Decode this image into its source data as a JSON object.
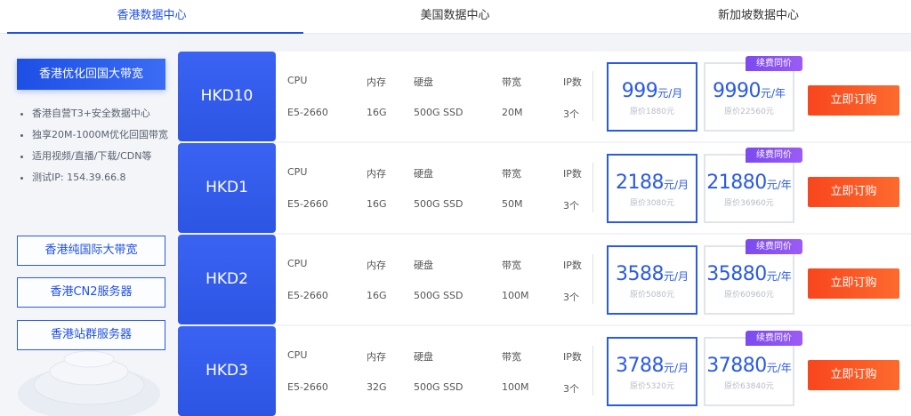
{
  "tabs": [
    {
      "label": "香港数据中心",
      "active": true
    },
    {
      "label": "美国数据中心",
      "active": false
    },
    {
      "label": "新加坡数据中心",
      "active": false
    }
  ],
  "sidebar": {
    "primary_button": "香港优化回国大带宽",
    "features": [
      "香港自营T3+安全数据中心",
      "独享20M-1000M优化回国带宽",
      "适用视频/直播/下载/CDN等",
      "测试IP: 154.39.66.8"
    ],
    "links": [
      "香港纯国际大带宽",
      "香港CN2服务器",
      "香港站群服务器"
    ]
  },
  "spec_headers": {
    "cpu": "CPU",
    "ram": "内存",
    "disk": "硬盘",
    "bandwidth": "带宽",
    "ip": "IP数"
  },
  "badge_label": "续费同价",
  "buy_label": "立即订购",
  "month_unit": "元/月",
  "year_unit": "元/年",
  "plans": [
    {
      "name": "HKD10",
      "cpu": "E5-2660",
      "ram": "16G",
      "disk": "500G SSD",
      "bandwidth": "20M",
      "ip": "3个",
      "monthly": "999",
      "monthly_orig": "原价1880元",
      "yearly": "9990",
      "yearly_orig": "原价22560元"
    },
    {
      "name": "HKD1",
      "cpu": "E5-2660",
      "ram": "16G",
      "disk": "500G SSD",
      "bandwidth": "50M",
      "ip": "3个",
      "monthly": "2188",
      "monthly_orig": "原价3080元",
      "yearly": "21880",
      "yearly_orig": "原价36960元"
    },
    {
      "name": "HKD2",
      "cpu": "E5-2660",
      "ram": "16G",
      "disk": "500G SSD",
      "bandwidth": "100M",
      "ip": "3个",
      "monthly": "3588",
      "monthly_orig": "原价5080元",
      "yearly": "35880",
      "yearly_orig": "原价60960元"
    },
    {
      "name": "HKD3",
      "cpu": "E5-2660",
      "ram": "32G",
      "disk": "500G SSD",
      "bandwidth": "100M",
      "ip": "3个",
      "monthly": "3788",
      "monthly_orig": "原价5320元",
      "yearly": "37880",
      "yearly_orig": "原价63840元"
    }
  ],
  "colors": {
    "accent_blue": "#1e50e6",
    "buy_red": "#f8461d",
    "badge_purple": "#8a52f3"
  }
}
